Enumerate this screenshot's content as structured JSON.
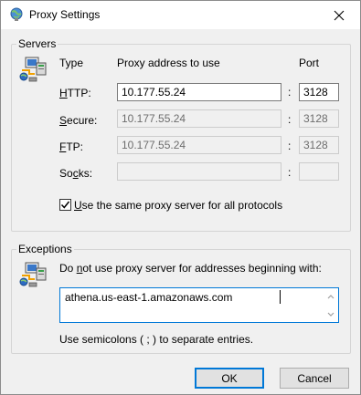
{
  "window": {
    "title": "Proxy Settings"
  },
  "servers": {
    "legend": "Servers",
    "col_type": "Type",
    "col_address": "Proxy address to use",
    "col_port": "Port",
    "rows": [
      {
        "label_u": "H",
        "label_rest": "TTP:",
        "address": "10.177.55.24",
        "port": "3128",
        "enabled": true
      },
      {
        "label_u": "S",
        "label_rest": "ecure:",
        "address": "10.177.55.24",
        "port": "3128",
        "enabled": false
      },
      {
        "label_u": "F",
        "label_rest": "TP:",
        "address": "10.177.55.24",
        "port": "3128",
        "enabled": false
      },
      {
        "label_pre": "So",
        "label_u": "c",
        "label_rest": "ks:",
        "address": "",
        "port": "",
        "enabled": false
      }
    ],
    "colon": ":",
    "same_proxy_u": "U",
    "same_proxy_rest": "se the same proxy server for all protocols",
    "same_proxy_checked": true
  },
  "exceptions": {
    "legend": "Exceptions",
    "instruction_pre": "Do ",
    "instruction_u": "n",
    "instruction_rest": "ot use proxy server for addresses beginning with:",
    "value": "athena.us-east-1.amazonaws.com",
    "hint": "Use semicolons ( ; ) to separate entries."
  },
  "buttons": {
    "ok": "OK",
    "cancel": "Cancel"
  },
  "icons": {
    "title": "globe-network-icon",
    "servers": "computer-network-icon",
    "exceptions": "computer-network-icon",
    "close": "close-icon"
  },
  "colors": {
    "accent": "#0078d7",
    "border": "#adadad",
    "background": "#f0f0f0"
  }
}
